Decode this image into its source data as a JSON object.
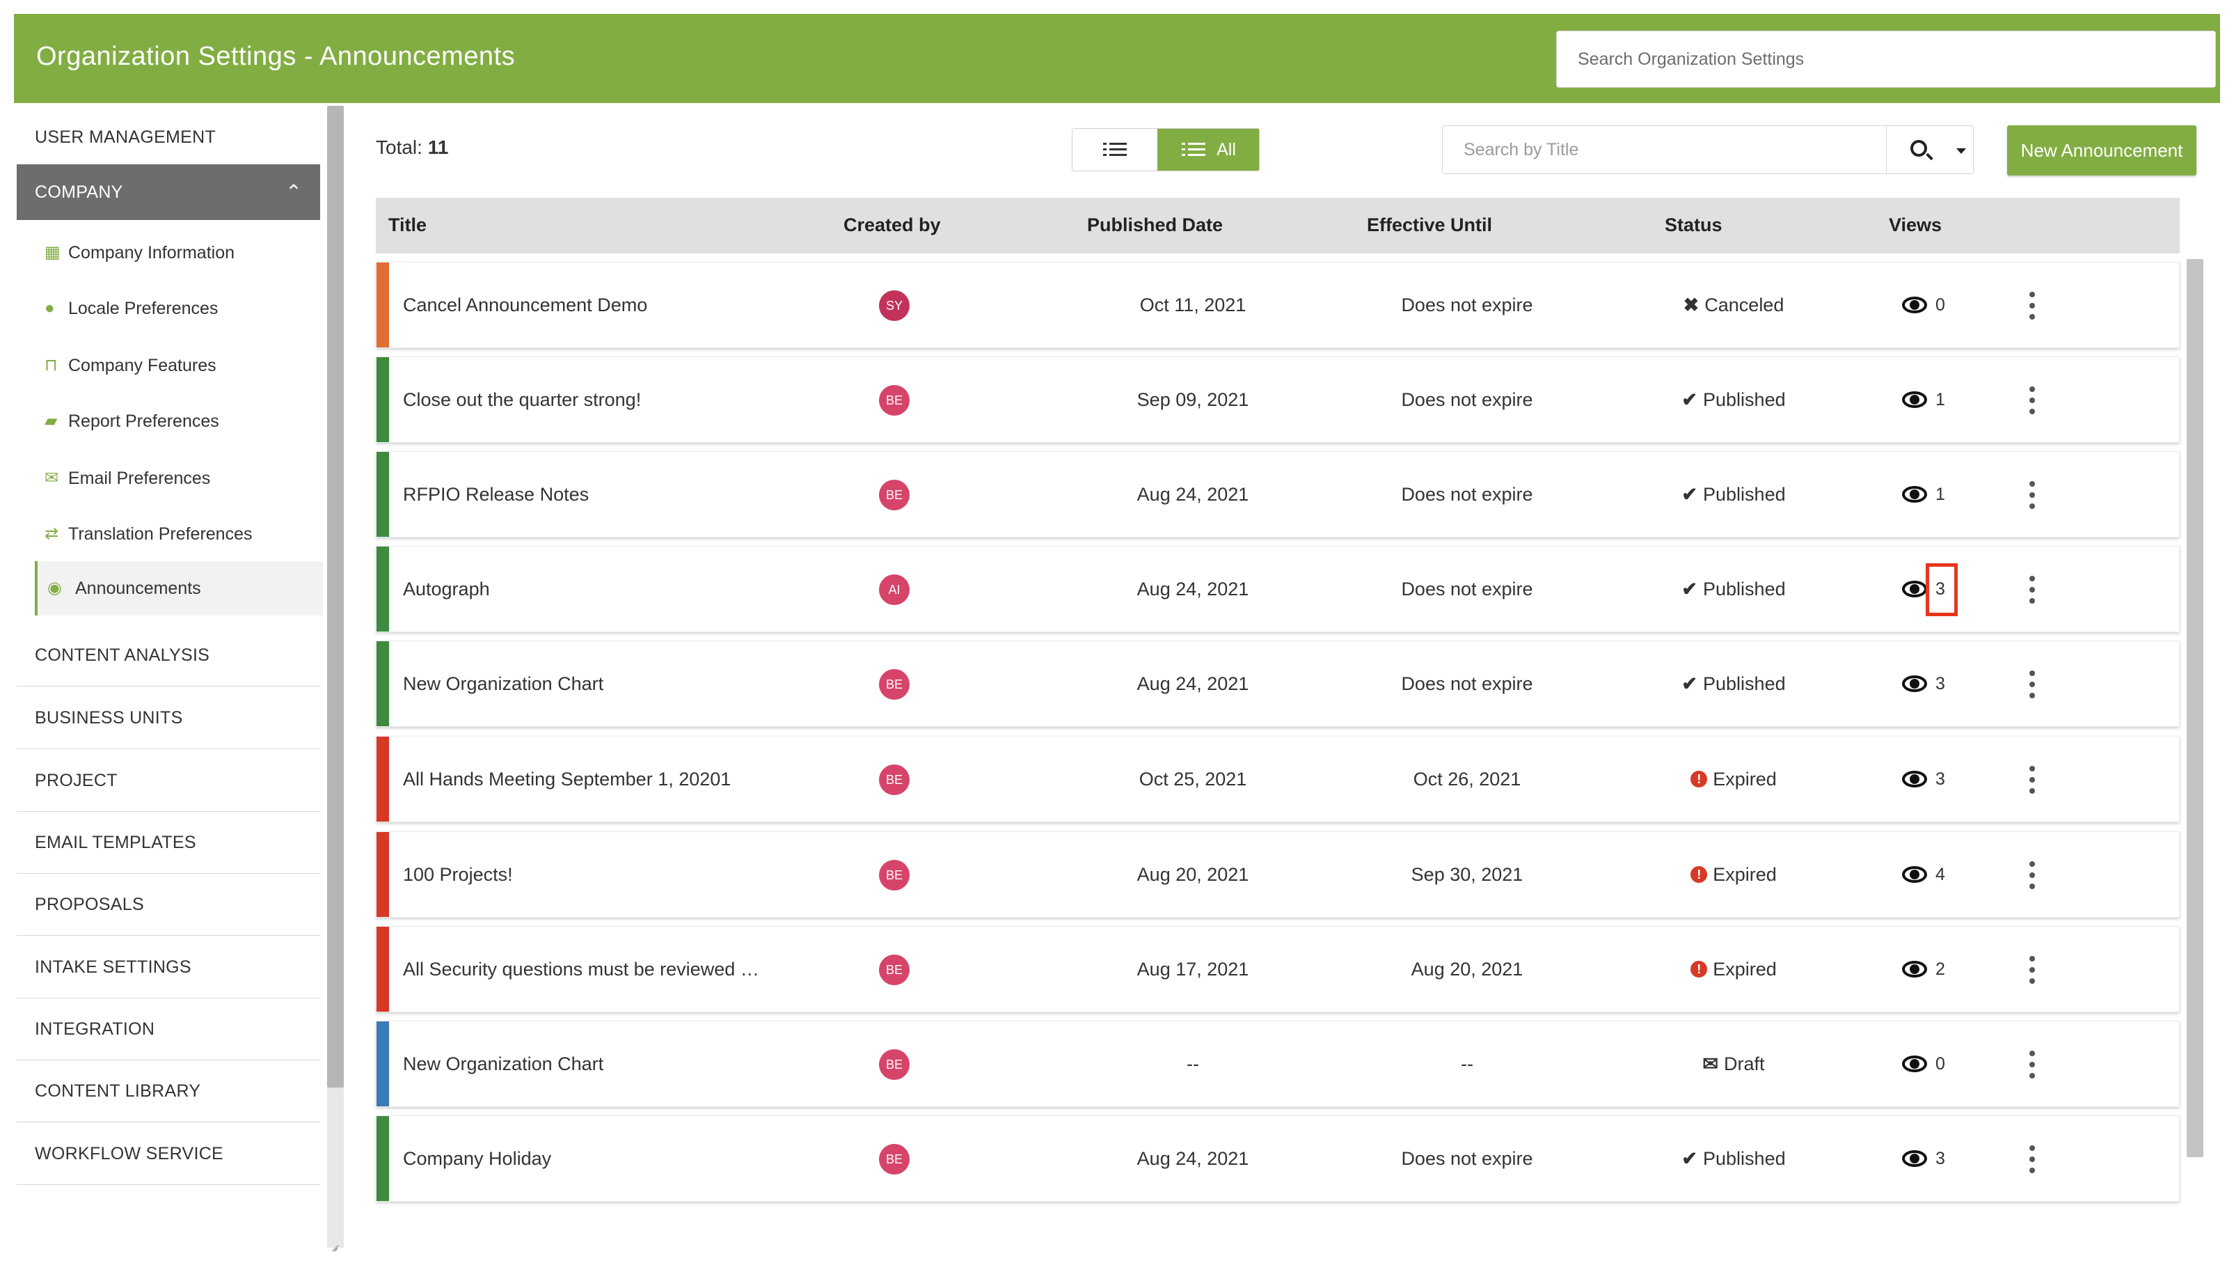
{
  "header": {
    "title": "Organization Settings - Announcements",
    "search_placeholder": "Search Organization Settings"
  },
  "sidebar": {
    "sections_top": [
      {
        "label": "USER MANAGEMENT"
      }
    ],
    "active_section": {
      "label": "COMPANY",
      "expanded": true
    },
    "sub_items": [
      {
        "label": "Company Information",
        "icon": "building-icon"
      },
      {
        "label": "Locale Preferences",
        "icon": "globe-icon"
      },
      {
        "label": "Company Features",
        "icon": "bookmark-icon"
      },
      {
        "label": "Report Preferences",
        "icon": "book-icon"
      },
      {
        "label": "Email Preferences",
        "icon": "envelope-icon"
      },
      {
        "label": "Translation Preferences",
        "icon": "translate-icon"
      },
      {
        "label": "Announcements",
        "icon": "podcast-icon",
        "selected": true
      }
    ],
    "sections_bottom": [
      {
        "label": "CONTENT ANALYSIS"
      },
      {
        "label": "BUSINESS UNITS"
      },
      {
        "label": "PROJECT"
      },
      {
        "label": "EMAIL TEMPLATES"
      },
      {
        "label": "PROPOSALS"
      },
      {
        "label": "INTAKE SETTINGS"
      },
      {
        "label": "INTEGRATION"
      },
      {
        "label": "CONTENT LIBRARY"
      },
      {
        "label": "WORKFLOW SERVICE"
      }
    ]
  },
  "toolbar": {
    "total_label": "Total:",
    "total_count": "11",
    "view_all_label": "All",
    "title_search_placeholder": "Search by Title",
    "new_button_label": "New Announcement"
  },
  "table": {
    "columns": [
      "Title",
      "Created by",
      "Published Date",
      "Effective Until",
      "Status",
      "Views"
    ],
    "rows": [
      {
        "title": "Cancel Announcement Demo",
        "creator": "SY",
        "published": "Oct 11, 2021",
        "effective": "Does not expire",
        "status": "Canceled",
        "views": "0",
        "accent": "#e06d32",
        "avatar_color": "#c2325b"
      },
      {
        "title": "Close out the quarter strong!",
        "creator": "BE",
        "published": "Sep 09, 2021",
        "effective": "Does not expire",
        "status": "Published",
        "views": "1",
        "accent": "#3e8a3f",
        "avatar_color": "#d6446a"
      },
      {
        "title": "RFPIO Release Notes",
        "creator": "BE",
        "published": "Aug 24, 2021",
        "effective": "Does not expire",
        "status": "Published",
        "views": "1",
        "accent": "#3e8a3f",
        "avatar_color": "#d6446a"
      },
      {
        "title": "Autograph",
        "creator": "AI",
        "published": "Aug 24, 2021",
        "effective": "Does not expire",
        "status": "Published",
        "views": "3",
        "accent": "#3e8a3f",
        "avatar_color": "#d6446a",
        "highlighted": true
      },
      {
        "title": "New Organization Chart",
        "creator": "BE",
        "published": "Aug 24, 2021",
        "effective": "Does not expire",
        "status": "Published",
        "views": "3",
        "accent": "#3e8a3f",
        "avatar_color": "#d6446a"
      },
      {
        "title": "All Hands Meeting September 1, 20201",
        "creator": "BE",
        "published": "Oct 25, 2021",
        "effective": "Oct 26, 2021",
        "status": "Expired",
        "views": "3",
        "accent": "#d63a26",
        "avatar_color": "#d6446a"
      },
      {
        "title": "100 Projects!",
        "creator": "BE",
        "published": "Aug 20, 2021",
        "effective": "Sep 30, 2021",
        "status": "Expired",
        "views": "4",
        "accent": "#d63a26",
        "avatar_color": "#d6446a"
      },
      {
        "title": "All Security questions must be reviewed …",
        "creator": "BE",
        "published": "Aug 17, 2021",
        "effective": "Aug 20, 2021",
        "status": "Expired",
        "views": "2",
        "accent": "#d63a26",
        "avatar_color": "#d6446a"
      },
      {
        "title": "New Organization Chart",
        "creator": "BE",
        "published": "--",
        "effective": "--",
        "status": "Draft",
        "views": "0",
        "accent": "#3d7ab8",
        "avatar_color": "#d6446a"
      },
      {
        "title": "Company Holiday",
        "creator": "BE",
        "published": "Aug 24, 2021",
        "effective": "Does not expire",
        "status": "Published",
        "views": "3",
        "accent": "#3e8a3f",
        "avatar_color": "#d6446a"
      }
    ]
  },
  "colors": {
    "brand": "#82ad43",
    "canceled": "#e06d32",
    "published": "#4a9b46",
    "expired": "#d63a26",
    "draft": "#3d87c5",
    "highlight": "#e6361b"
  }
}
